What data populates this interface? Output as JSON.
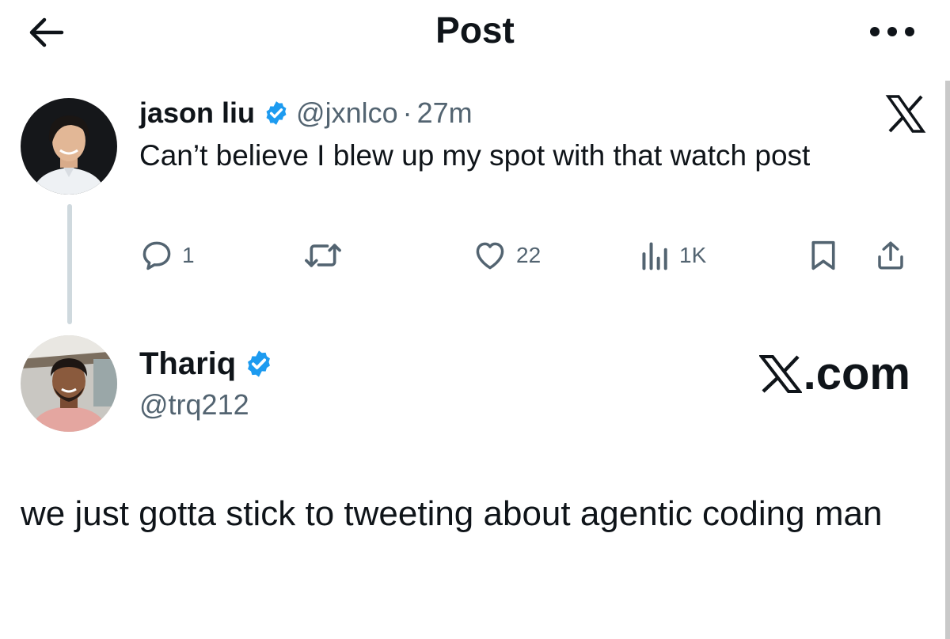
{
  "header": {
    "title": "Post",
    "back_icon": "arrow-left-icon",
    "more_icon": "more-icon"
  },
  "post1": {
    "author_name": "jason liu",
    "handle": "@jxnlco",
    "separator": "·",
    "time": "27m",
    "text": "Can’t believe I blew up my spot with that watch post",
    "actions": {
      "replies": "1",
      "reposts": "",
      "likes": "22",
      "views": "1K"
    },
    "brand_icon": "x-logo-icon"
  },
  "post2": {
    "author_name": "Thariq",
    "handle": "@trq212",
    "brand_text": ".com",
    "text": "we just gotta stick to tweeting about agentic coding man"
  },
  "colors": {
    "verified": "#1d9bf0",
    "secondary_text": "#536471",
    "primary_text": "#0f1419"
  }
}
